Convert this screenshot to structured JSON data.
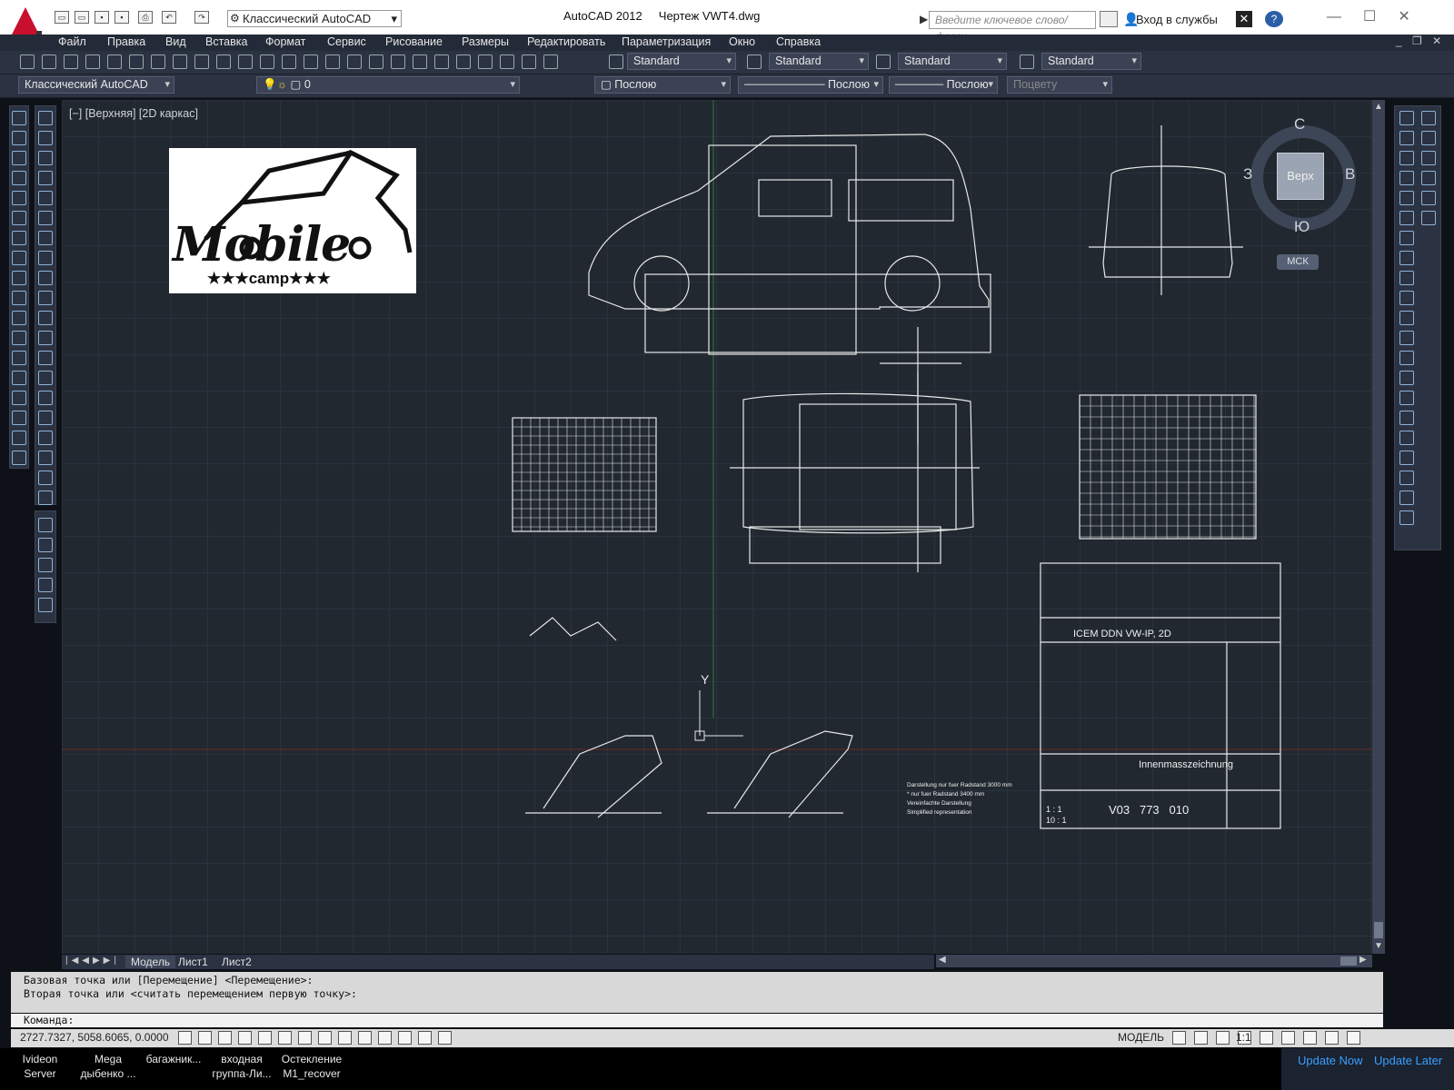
{
  "window": {
    "title": "AutoCAD 2012     Чертеж VWT4.dwg",
    "workspace": "Классический AutoCAD",
    "search_placeholder": "Введите ключевое слово/фразу",
    "sign_in": "Вход в службы"
  },
  "menu": [
    "Файл",
    "Правка",
    "Вид",
    "Вставка",
    "Формат",
    "Сервис",
    "Рисование",
    "Размеры",
    "Редактировать",
    "Параметризация",
    "Окно",
    "Справка"
  ],
  "styles_toolbar": {
    "text_style": "Standard",
    "dim_style": "Standard",
    "table_style": "Standard",
    "mleader_style": "Standard"
  },
  "properties_toolbar": {
    "workspace": "Классический AutoCAD",
    "layer": "0",
    "color": "Послою",
    "linetype": "Послою",
    "lineweight": "Послою",
    "plot_style": "Поцвету"
  },
  "viewport": {
    "label": "[−] [Верхняя] [2D каркас]"
  },
  "logo": {
    "brand": "Mobile",
    "sub": "★★★camp★★★"
  },
  "viewcube": {
    "face": "Верх",
    "north": "С",
    "south": "Ю",
    "east": "В",
    "west": "З",
    "wcs": "МСК"
  },
  "drawing": {
    "title_block_name": "ICEM DDN VW-IP, 2D",
    "title_block_desc": "Innenmasszeichnung",
    "scale_1": "1 : 1",
    "scale_2": "10 : 1",
    "part_number": "V03   773   010",
    "note_lines": [
      "Darstellung nur fuer Radstand 3000 mm",
      "* nur fuer Radstand 3400 mm",
      "Vereinfachte Darstellung",
      "Simplified representation"
    ],
    "ucs_y": "Y"
  },
  "tabs": [
    "Модель",
    "Лист1",
    "Лист2"
  ],
  "command_line": {
    "history": [
      "Базовая точка или [Перемещение] <Перемещение>:",
      "Вторая точка или <считать перемещением первую точку>:"
    ],
    "prompt": "Команда:"
  },
  "status": {
    "coords": "2727.7327, 5058.6065, 0.0000",
    "space": "МОДЕЛЬ",
    "scale": "1:1"
  },
  "taskbar": {
    "items": [
      "Ivideon\nServer",
      "Mega\nдыбенко ...",
      "багажник...",
      "входная\nгруппа-Ли...",
      "Остекление\nM1_recover"
    ],
    "update_now": "Update Now",
    "update_later": "Update Later"
  }
}
